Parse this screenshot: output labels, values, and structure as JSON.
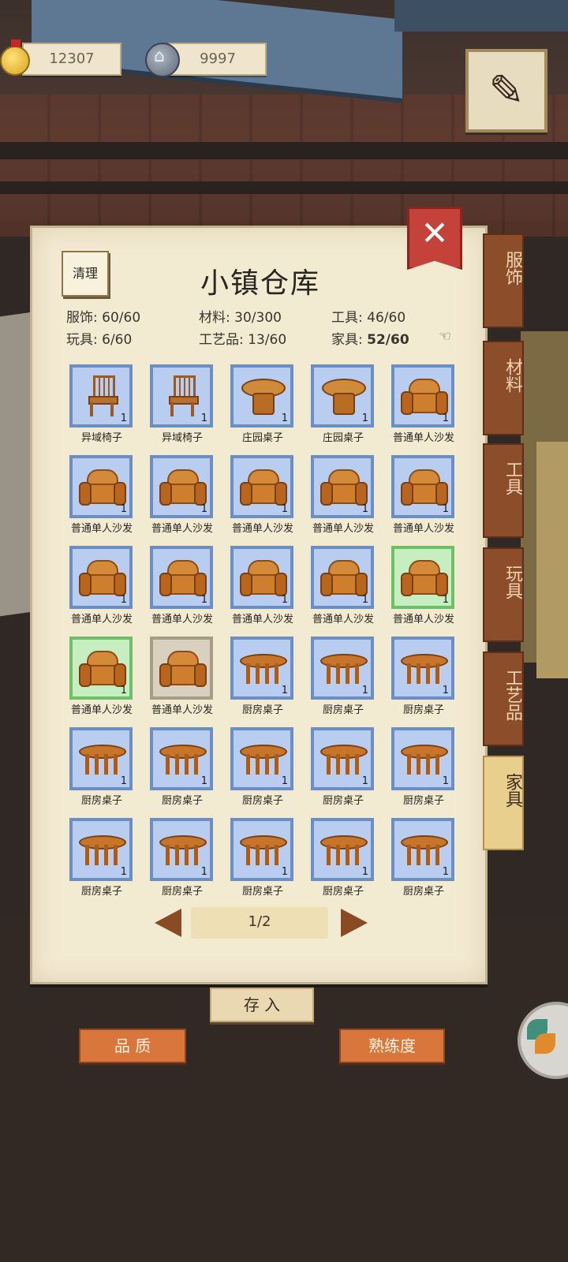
{
  "currency": {
    "gold": "12307",
    "silver": "9997"
  },
  "panel": {
    "title": "小镇仓库",
    "clean_label": "清理",
    "close_icon": "close-icon"
  },
  "stats": {
    "clothing_label": "服饰:",
    "clothing_value": "60/60",
    "materials_label": "材料:",
    "materials_value": "30/300",
    "tools_label": "工具:",
    "tools_value": "46/60",
    "toys_label": "玩具:",
    "toys_value": "6/60",
    "crafts_label": "工艺品:",
    "crafts_value": "13/60",
    "furniture_label": "家具:",
    "furniture_value": "52/60"
  },
  "items": [
    {
      "name": "异域椅子",
      "qty": "1",
      "kind": "chair",
      "frame": "blue"
    },
    {
      "name": "异域椅子",
      "qty": "1",
      "kind": "chair",
      "frame": "blue"
    },
    {
      "name": "庄园桌子",
      "qty": "1",
      "kind": "round-table",
      "frame": "blue"
    },
    {
      "name": "庄园桌子",
      "qty": "1",
      "kind": "round-table",
      "frame": "blue"
    },
    {
      "name": "普通单人沙发",
      "qty": "1",
      "kind": "sofa",
      "frame": "blue"
    },
    {
      "name": "普通单人沙发",
      "qty": "1",
      "kind": "sofa",
      "frame": "blue"
    },
    {
      "name": "普通单人沙发",
      "qty": "1",
      "kind": "sofa",
      "frame": "blue"
    },
    {
      "name": "普通单人沙发",
      "qty": "1",
      "kind": "sofa",
      "frame": "blue"
    },
    {
      "name": "普通单人沙发",
      "qty": "1",
      "kind": "sofa",
      "frame": "blue"
    },
    {
      "name": "普通单人沙发",
      "qty": "1",
      "kind": "sofa",
      "frame": "blue"
    },
    {
      "name": "普通单人沙发",
      "qty": "1",
      "kind": "sofa",
      "frame": "blue"
    },
    {
      "name": "普通单人沙发",
      "qty": "1",
      "kind": "sofa",
      "frame": "blue"
    },
    {
      "name": "普通单人沙发",
      "qty": "1",
      "kind": "sofa",
      "frame": "blue"
    },
    {
      "name": "普通单人沙发",
      "qty": "1",
      "kind": "sofa",
      "frame": "blue"
    },
    {
      "name": "普通单人沙发",
      "qty": "1",
      "kind": "sofa",
      "frame": "green"
    },
    {
      "name": "普通单人沙发",
      "qty": "1",
      "kind": "sofa",
      "frame": "green"
    },
    {
      "name": "普通单人沙发",
      "qty": "",
      "kind": "sofa",
      "frame": "tan"
    },
    {
      "name": "厨房桌子",
      "qty": "1",
      "kind": "table",
      "frame": "blue"
    },
    {
      "name": "厨房桌子",
      "qty": "1",
      "kind": "table",
      "frame": "blue"
    },
    {
      "name": "厨房桌子",
      "qty": "1",
      "kind": "table",
      "frame": "blue"
    },
    {
      "name": "厨房桌子",
      "qty": "1",
      "kind": "table",
      "frame": "blue"
    },
    {
      "name": "厨房桌子",
      "qty": "1",
      "kind": "table",
      "frame": "blue"
    },
    {
      "name": "厨房桌子",
      "qty": "1",
      "kind": "table",
      "frame": "blue"
    },
    {
      "name": "厨房桌子",
      "qty": "1",
      "kind": "table",
      "frame": "blue"
    },
    {
      "name": "厨房桌子",
      "qty": "1",
      "kind": "table",
      "frame": "blue"
    },
    {
      "name": "厨房桌子",
      "qty": "1",
      "kind": "table",
      "frame": "blue"
    },
    {
      "name": "厨房桌子",
      "qty": "1",
      "kind": "table",
      "frame": "blue"
    },
    {
      "name": "厨房桌子",
      "qty": "1",
      "kind": "table",
      "frame": "blue"
    },
    {
      "name": "厨房桌子",
      "qty": "1",
      "kind": "table",
      "frame": "blue"
    },
    {
      "name": "厨房桌子",
      "qty": "1",
      "kind": "table",
      "frame": "blue"
    }
  ],
  "pager": {
    "text": "1/2"
  },
  "tabs": [
    {
      "label": "服饰",
      "active": false
    },
    {
      "label": "材料",
      "active": false
    },
    {
      "label": "工具",
      "active": false
    },
    {
      "label": "玩具",
      "active": false
    },
    {
      "label": "工艺品",
      "active": false
    },
    {
      "label": "家具",
      "active": true
    }
  ],
  "buttons": {
    "deposit": "存 入",
    "quality": "品 质",
    "proficiency": "熟练度"
  },
  "colors": {
    "frame_blue": "#6b8fc2",
    "frame_green": "#6fbf66",
    "frame_tan": "#a89c86",
    "tab_brown": "#8c4d2a",
    "tab_active": "#e8cf8e",
    "close_red": "#c4423a"
  }
}
